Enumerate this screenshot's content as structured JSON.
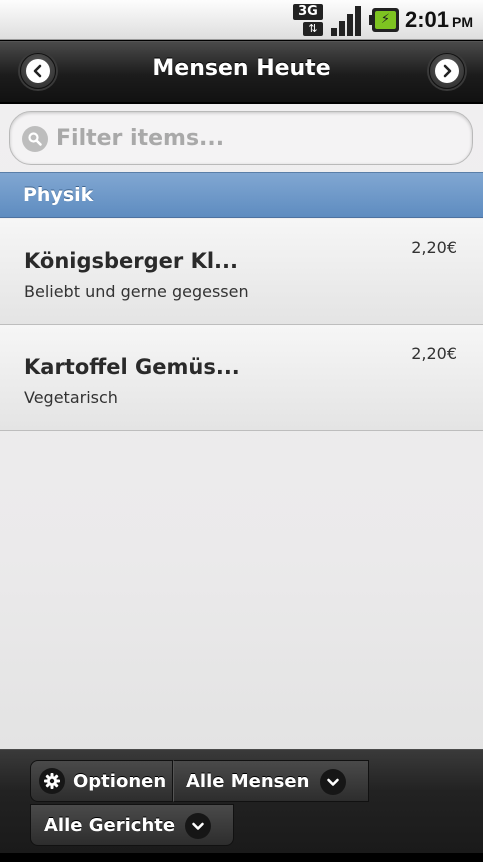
{
  "status_bar": {
    "network_label": "3G",
    "network_arrows": "⇅",
    "time": "2:01",
    "ampm": "PM",
    "battery_symbol": "⚡",
    "icons": [
      "3g-icon",
      "signal-icon",
      "battery-charging-icon"
    ]
  },
  "header": {
    "title": "Mensen Heute",
    "back_icon": "chevron-left-icon",
    "forward_icon": "chevron-right-icon"
  },
  "search": {
    "placeholder": "Filter items...",
    "value": ""
  },
  "group": {
    "title": "Physik"
  },
  "items": [
    {
      "name": "Königsberger Kl...",
      "description": "Beliebt und gerne gegessen",
      "price": "2,20€"
    },
    {
      "name": "Kartoffel Gemüs...",
      "description": "Vegetarisch",
      "price": "2,20€"
    }
  ],
  "footer": {
    "options_label": "Optionen",
    "mensen_label": "Alle Mensen",
    "gerichte_label": "Alle Gerichte"
  },
  "colors": {
    "header_bg": "#1c1c1c",
    "divider_bg": "#6d97c8",
    "battery_fill": "#7ec321"
  }
}
